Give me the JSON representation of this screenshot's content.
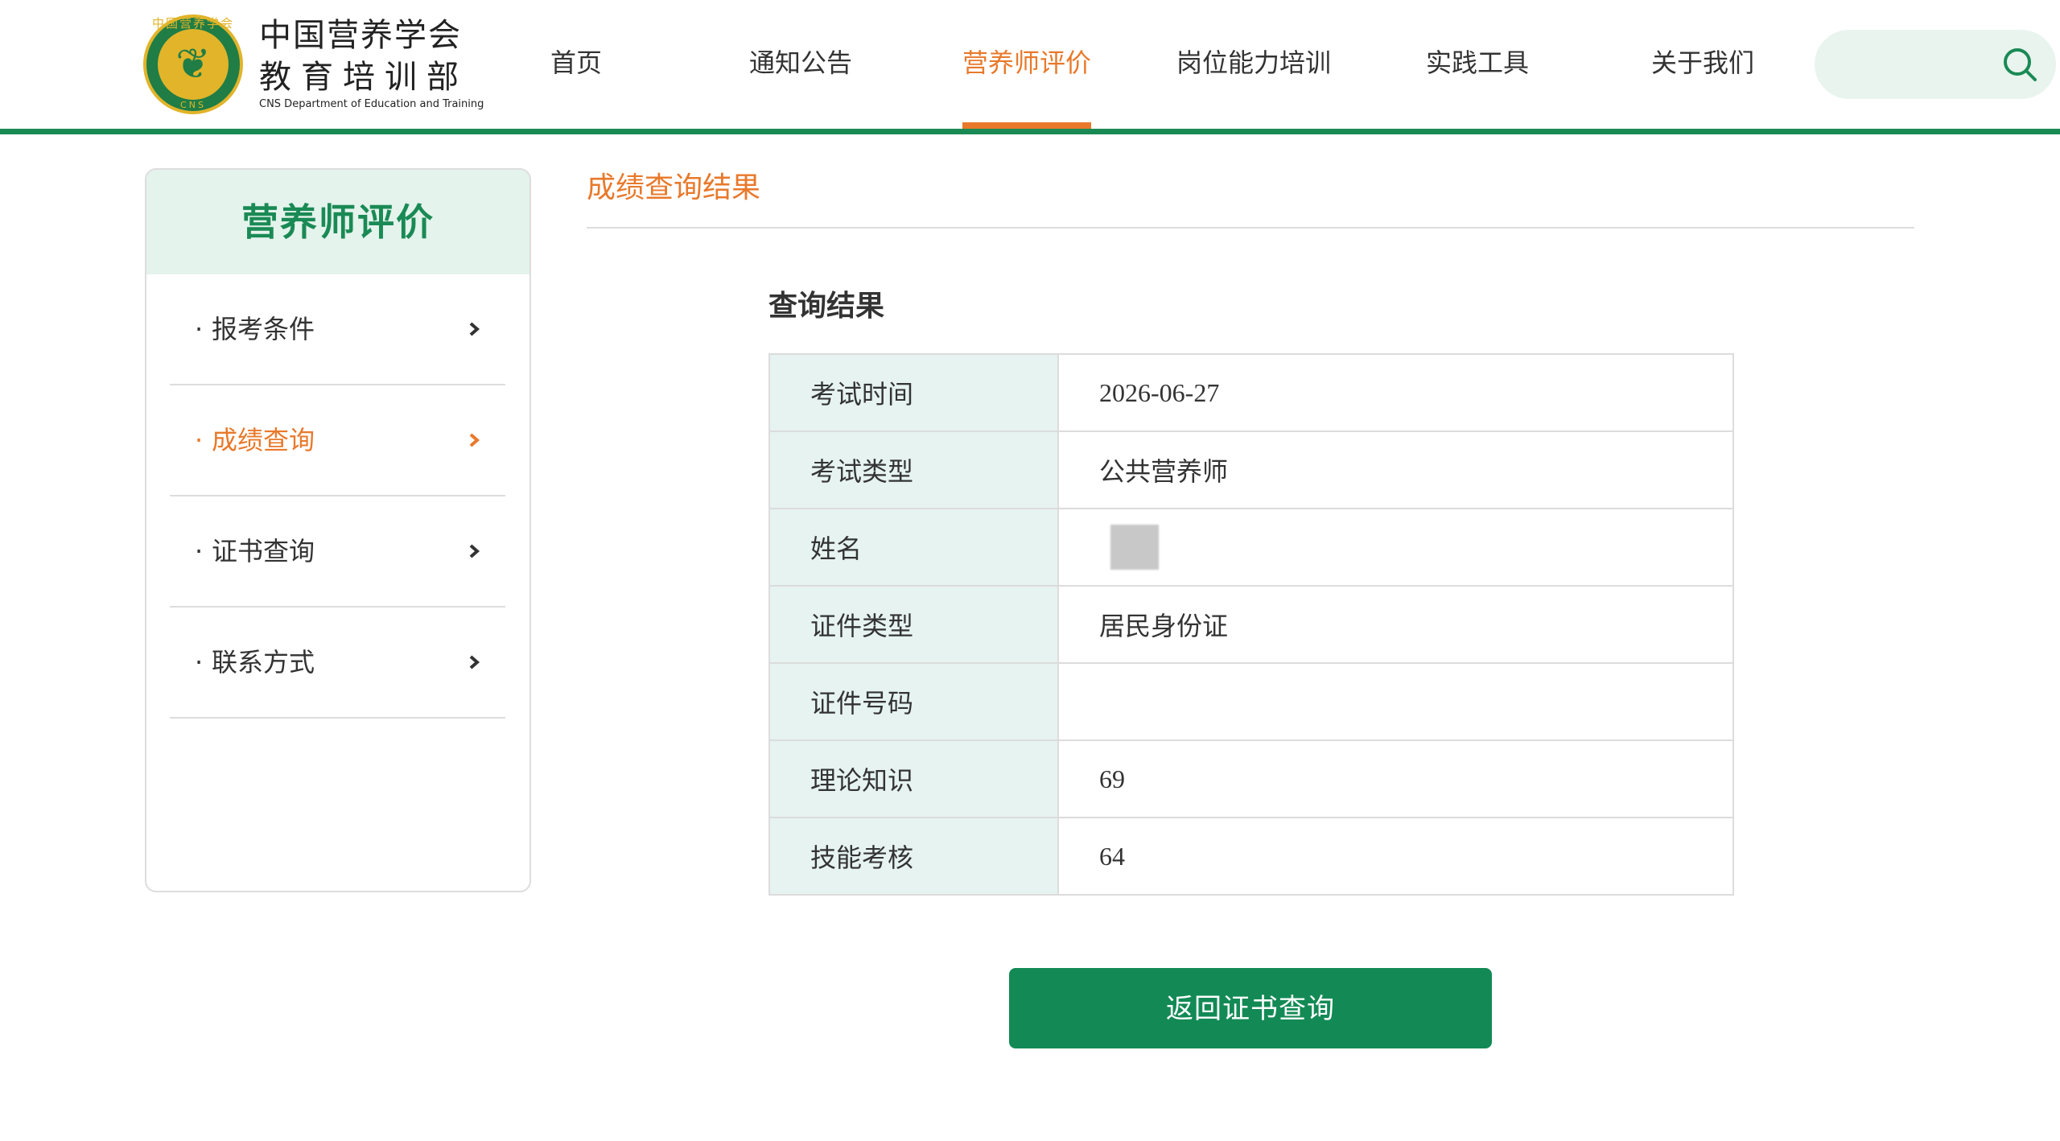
{
  "brand": {
    "name_line1": "中国营养学会",
    "name_line2": "教育培训部",
    "english": "CNS Department of Education and Training",
    "emblem_top": "中国营养学会",
    "emblem_bottom": "CNS"
  },
  "nav": {
    "items": [
      {
        "label": "首页"
      },
      {
        "label": "通知公告"
      },
      {
        "label": "营养师评价",
        "active": true
      },
      {
        "label": "岗位能力培训"
      },
      {
        "label": "实践工具"
      },
      {
        "label": "关于我们"
      }
    ],
    "search_icon": "search-icon"
  },
  "sidebar": {
    "title": "营养师评价",
    "items": [
      {
        "label": "报考条件"
      },
      {
        "label": "成绩查询",
        "active": true
      },
      {
        "label": "证书查询"
      },
      {
        "label": "联系方式"
      }
    ]
  },
  "main": {
    "page_title": "成绩查询结果",
    "section_title": "查询结果",
    "rows": [
      {
        "key": "考试时间",
        "value": "2026-06-27"
      },
      {
        "key": "考试类型",
        "value": "公共营养师"
      },
      {
        "key": "姓名",
        "value": ""
      },
      {
        "key": "证件类型",
        "value": "居民身份证"
      },
      {
        "key": "证件号码",
        "value": ""
      },
      {
        "key": "理论知识",
        "value": "69"
      },
      {
        "key": "技能考核",
        "value": "64"
      }
    ],
    "back_button": "返回证书查询"
  },
  "colors": {
    "brand_green": "#1a8a55",
    "accent_orange": "#e8792b",
    "button_green": "#138a55"
  }
}
